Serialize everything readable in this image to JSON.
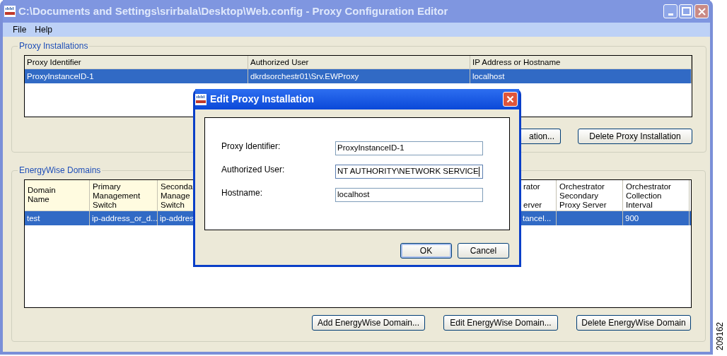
{
  "window": {
    "title": "C:\\Documents and Settings\\srirbala\\Desktop\\Web.config - Proxy Configuration Editor",
    "active": false,
    "controls": [
      {
        "kind": "minimize"
      },
      {
        "kind": "maximize"
      },
      {
        "kind": "close"
      }
    ]
  },
  "menu": [
    "File",
    "Help"
  ],
  "proxy_installations": {
    "title": "Proxy Installations",
    "columns": [
      "Proxy Identifier",
      "Authorized User",
      "IP Address or Hostname"
    ],
    "rows": [
      {
        "selected": true,
        "cells": [
          "ProxyInstanceID-1",
          "dkrdsorchestr01\\Srv.EWProxy",
          "localhost"
        ]
      }
    ],
    "buttons": [
      "ation...",
      "Delete Proxy Installation"
    ]
  },
  "energywise_domains": {
    "title": "EnergyWise Domains",
    "columns": [
      {
        "label": "Domain\nName",
        "highlighted": true
      },
      {
        "label": "Primary\nManagement\nSwitch",
        "highlighted": true
      },
      {
        "label": "Seconda\nManage\nSwitch",
        "highlighted": true
      },
      {
        "label": "rator\n\nerver",
        "highlighted": false
      },
      {
        "label": "Orchestrator\nSecondary\nProxy Server",
        "highlighted": false
      },
      {
        "label": "Orchestrator\nCollection\nInterval",
        "highlighted": false
      }
    ],
    "rows": [
      {
        "selected": true,
        "cells": [
          "test",
          "ip-address_or_d...",
          "ip-addres",
          "tancel...",
          null,
          "900"
        ]
      }
    ],
    "buttons": [
      "Add EnergyWise Domain...",
      "Edit EnergyWise Domain...",
      "Delete EnergyWise Domain"
    ]
  },
  "dialog": {
    "title": "Edit Proxy Installation",
    "fields": [
      {
        "label": "Proxy Identifier:",
        "value": "ProxyInstanceID-1",
        "focused": false
      },
      {
        "label": "Authorized User:",
        "value": "NT AUTHORITY\\NETWORK SERVICE",
        "focused": true
      },
      {
        "label": "Hostname:",
        "value": "localhost",
        "focused": false
      }
    ],
    "buttons": [
      {
        "label": "OK",
        "default": true
      },
      {
        "label": "Cancel",
        "default": false
      }
    ]
  },
  "figure_number": "209162"
}
